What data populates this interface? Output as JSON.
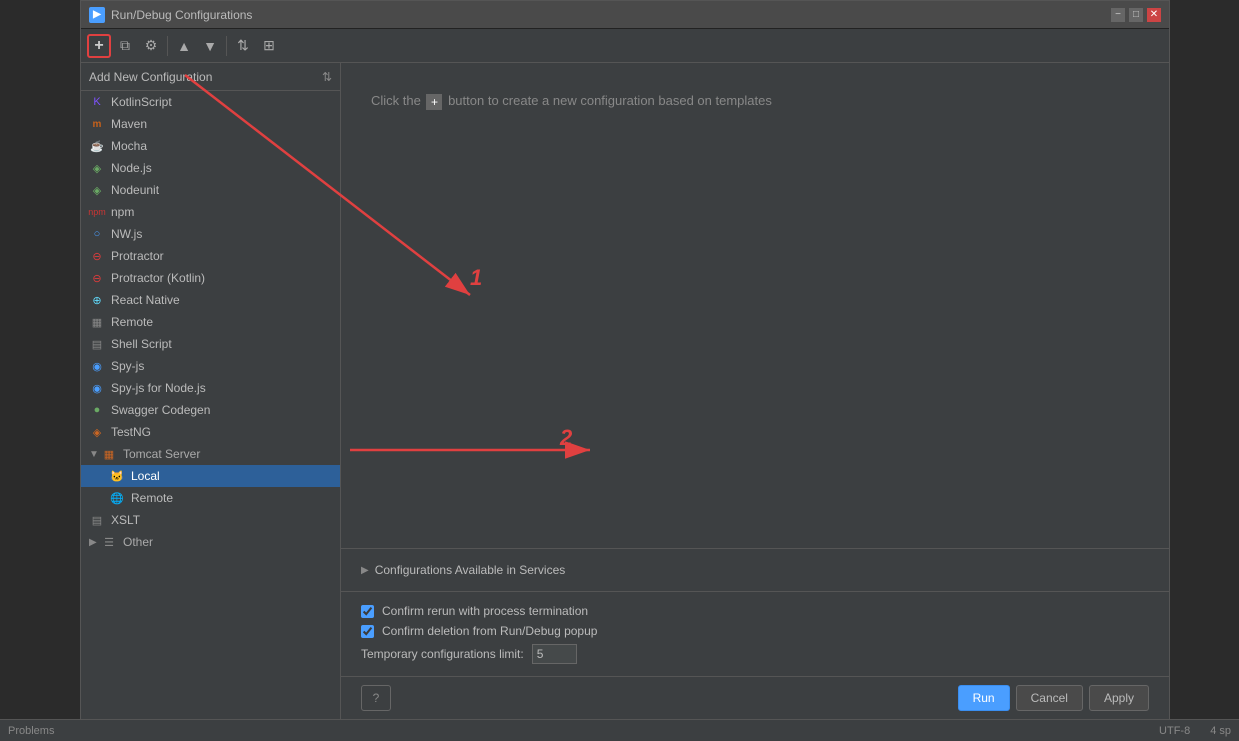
{
  "dialog": {
    "title": "Run/Debug Configurations",
    "toolbar": {
      "add_label": "+",
      "copy_label": "⧉",
      "settings_label": "⚙",
      "up_label": "▲",
      "down_label": "▼",
      "sort_label": "⇅",
      "filter_label": "⊞"
    },
    "config_header": "Add New Configuration",
    "hint": "Click the + button to create a new configuration based on templates",
    "configs": [
      {
        "id": "kotlin-script",
        "label": "KotlinScript",
        "icon": "K",
        "iconClass": "icon-kotlin",
        "indent": 0
      },
      {
        "id": "maven",
        "label": "Maven",
        "icon": "m",
        "iconClass": "icon-maven",
        "indent": 0
      },
      {
        "id": "mocha",
        "label": "Mocha",
        "icon": "●",
        "iconClass": "icon-mocha",
        "indent": 0
      },
      {
        "id": "node",
        "label": "Node.js",
        "icon": "◈",
        "iconClass": "icon-node",
        "indent": 0
      },
      {
        "id": "nodeunit",
        "label": "Nodeunit",
        "icon": "◈",
        "iconClass": "icon-node",
        "indent": 0
      },
      {
        "id": "npm",
        "label": "npm",
        "icon": "◆",
        "iconClass": "icon-npm",
        "indent": 0
      },
      {
        "id": "nw",
        "label": "NW.js",
        "icon": "○",
        "iconClass": "icon-nw",
        "indent": 0
      },
      {
        "id": "protractor",
        "label": "Protractor",
        "icon": "⊖",
        "iconClass": "icon-protractor",
        "indent": 0
      },
      {
        "id": "protractor-kotlin",
        "label": "Protractor (Kotlin)",
        "icon": "⊖",
        "iconClass": "icon-protractor",
        "indent": 0
      },
      {
        "id": "react-native",
        "label": "React Native",
        "icon": "⊕",
        "iconClass": "icon-react",
        "indent": 0
      },
      {
        "id": "remote",
        "label": "Remote",
        "icon": "▦",
        "iconClass": "icon-remote",
        "indent": 0
      },
      {
        "id": "shell-script",
        "label": "Shell Script",
        "icon": "▤",
        "iconClass": "icon-shell",
        "indent": 0
      },
      {
        "id": "spy-js",
        "label": "Spy-js",
        "icon": "◉",
        "iconClass": "icon-spy",
        "indent": 0
      },
      {
        "id": "spy-js-node",
        "label": "Spy-js for Node.js",
        "icon": "◉",
        "iconClass": "icon-spy",
        "indent": 0
      },
      {
        "id": "swagger",
        "label": "Swagger Codegen",
        "icon": "●",
        "iconClass": "icon-swagger",
        "indent": 0
      },
      {
        "id": "testng",
        "label": "TestNG",
        "icon": "◈",
        "iconClass": "icon-testng",
        "indent": 0
      },
      {
        "id": "tomcat-group",
        "label": "Tomcat Server",
        "icon": "▼",
        "iconClass": "icon-tomcat",
        "indent": 0,
        "isGroup": true,
        "expanded": true
      },
      {
        "id": "tomcat-local",
        "label": "Local",
        "icon": "🐱",
        "iconClass": "icon-tomcat",
        "indent": 1,
        "selected": true
      },
      {
        "id": "tomcat-remote",
        "label": "Remote",
        "icon": "🌐",
        "iconClass": "icon-remote",
        "indent": 1
      },
      {
        "id": "xslt",
        "label": "XSLT",
        "icon": "▤",
        "iconClass": "icon-xslt",
        "indent": 0
      },
      {
        "id": "other-group",
        "label": "Other",
        "icon": "▶",
        "iconClass": "icon-other",
        "indent": 0,
        "isGroup": true
      }
    ],
    "services_section": {
      "label": "Configurations Available in Services"
    },
    "checkboxes": [
      {
        "id": "confirm-rerun",
        "label": "Confirm rerun with process termination",
        "checked": true
      },
      {
        "id": "confirm-delete",
        "label": "Confirm deletion from Run/Debug popup",
        "checked": true
      }
    ],
    "temp_limit": {
      "label": "Temporary configurations limit:",
      "value": "5"
    },
    "buttons": {
      "help": "?",
      "run": "Run",
      "cancel": "Cancel",
      "apply": "Apply"
    }
  },
  "annotations": {
    "number1": "1",
    "number2": "2"
  },
  "status_bar": {
    "problems": "Problems",
    "encoding": "UTF-8",
    "spaces": "4 sp"
  }
}
